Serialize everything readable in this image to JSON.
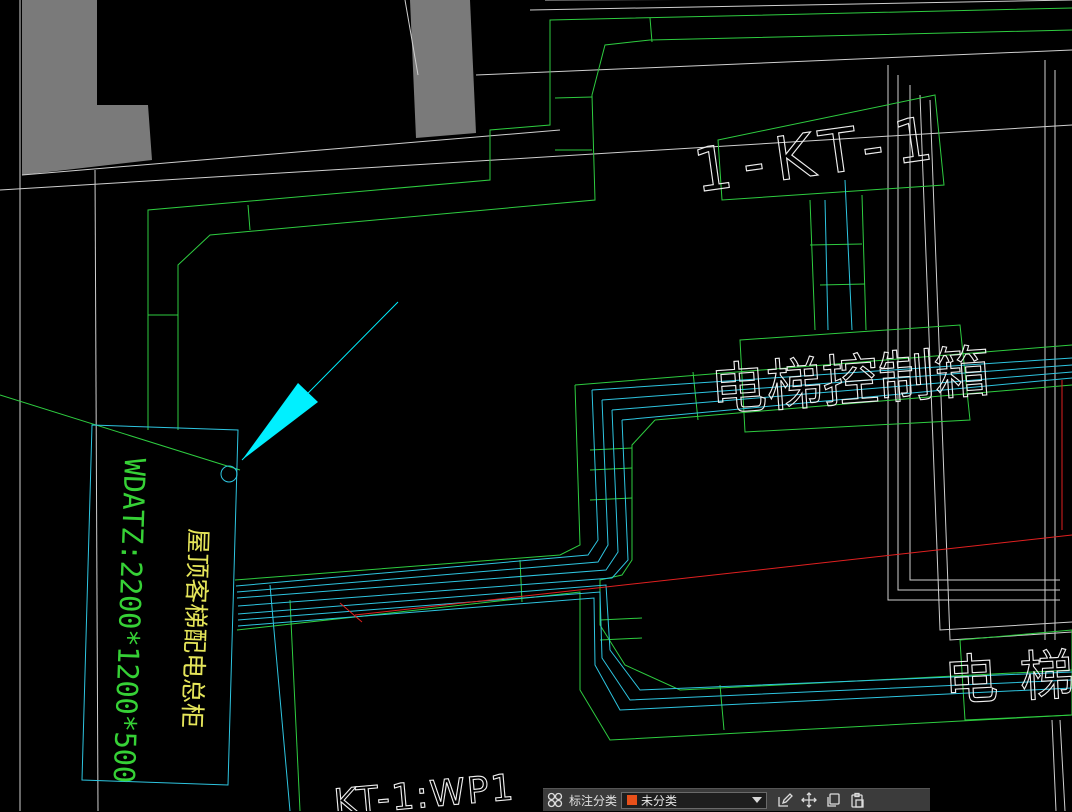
{
  "drawing": {
    "tag_kt": "1-KT-1",
    "label_elevator_box_1": "电梯控制箱",
    "label_elevator_box_2": "电梯",
    "label_cabinet_code": "WDATZ:2200*1200*500",
    "label_cabinet_name": "屋顶客梯配电总柜",
    "label_bottom_circuit": "KT-1:WP1",
    "colors": {
      "wall": "#7a7a7a",
      "duct": "#2ecc40",
      "cable": "#2ec5e0",
      "leader": "#00f0ff",
      "red_line": "#e02020",
      "white_line": "#cfcfcf"
    }
  },
  "toolbar": {
    "category_label": "标注分类",
    "category_value": "未分类",
    "category_color": "#e8501a",
    "icons": [
      "grid-icon",
      "edit-icon",
      "move-icon",
      "copy-icon",
      "paste-icon"
    ]
  }
}
